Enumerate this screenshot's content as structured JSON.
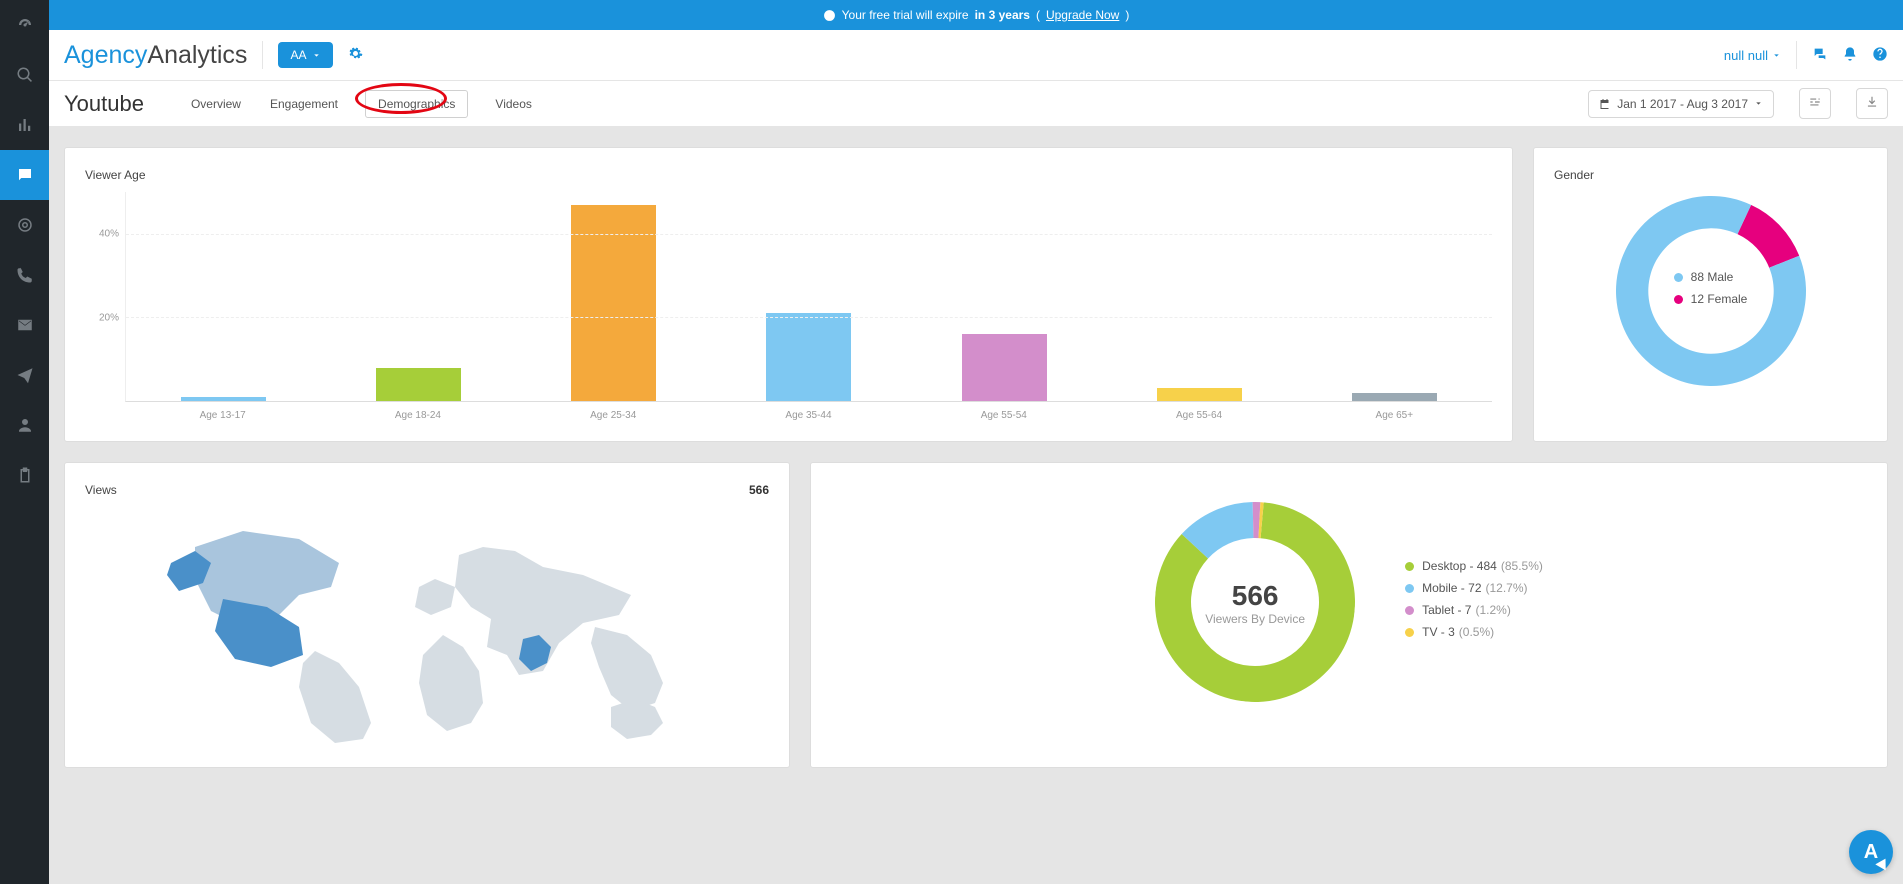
{
  "trial": {
    "prefix": "Your free trial will expire",
    "bold": "in 3 years",
    "upgrade": "Upgrade Now"
  },
  "brand": {
    "part1": "Agency",
    "part2": "Analytics"
  },
  "header": {
    "aa_label": "AA",
    "user": "null null"
  },
  "page": {
    "title": "Youtube",
    "tabs": [
      "Overview",
      "Engagement",
      "Demographics",
      "Videos"
    ],
    "date_range": "Jan 1 2017 - Aug 3 2017"
  },
  "cards": {
    "viewer_age_title": "Viewer Age",
    "gender_title": "Gender",
    "views_title": "Views",
    "views_total": "566",
    "device_total": "566",
    "device_sub": "Viewers By Device"
  },
  "chart_data": {
    "viewer_age": {
      "type": "bar",
      "yticks": [
        "20%",
        "40%"
      ],
      "ylim": [
        0,
        50
      ],
      "categories": [
        "Age 13-17",
        "Age 18-24",
        "Age 25-34",
        "Age 35-44",
        "Age 55-54",
        "Age 55-64",
        "Age 65+"
      ],
      "values": [
        1,
        8,
        47,
        21,
        16,
        3,
        2
      ],
      "colors": [
        "#7ec8f2",
        "#a6ce39",
        "#f4a93c",
        "#7ec8f2",
        "#d38ecb",
        "#f7d14a",
        "#9aa9b3"
      ]
    },
    "gender": {
      "type": "pie",
      "series": [
        {
          "name": "Male",
          "label": "88 Male",
          "value": 88,
          "color": "#7ec8f2"
        },
        {
          "name": "Female",
          "label": "12 Female",
          "value": 12,
          "color": "#e6007e"
        }
      ]
    },
    "device": {
      "type": "pie",
      "center_value": 566,
      "center_label": "Viewers By Device",
      "series": [
        {
          "name": "Desktop",
          "value": 484,
          "pct": "85.5%",
          "label": "Desktop - 484",
          "color": "#a6ce39"
        },
        {
          "name": "Mobile",
          "value": 72,
          "pct": "12.7%",
          "label": "Mobile - 72",
          "color": "#7ec8f2"
        },
        {
          "name": "Tablet",
          "value": 7,
          "pct": "1.2%",
          "label": "Tablet - 7",
          "color": "#d38ecb"
        },
        {
          "name": "TV",
          "value": 3,
          "pct": "0.5%",
          "label": "TV - 3",
          "color": "#f7d14a"
        }
      ]
    },
    "views_map": {
      "type": "map",
      "total": 566
    }
  }
}
